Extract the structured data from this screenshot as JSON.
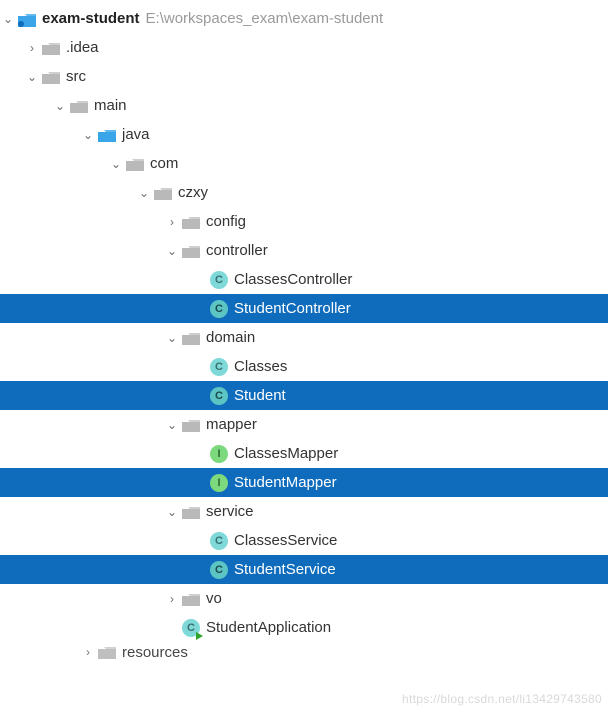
{
  "root": {
    "name": "exam-student",
    "path": "E:\\workspaces_exam\\exam-student"
  },
  "nodes": {
    "idea": ".idea",
    "src": "src",
    "main": "main",
    "java": "java",
    "com": "com",
    "czxy": "czxy",
    "config": "config",
    "controller": "controller",
    "classesController": "ClassesController",
    "studentController": "StudentController",
    "domain": "domain",
    "classes": "Classes",
    "student": "Student",
    "mapper": "mapper",
    "classesMapper": "ClassesMapper",
    "studentMapper": "StudentMapper",
    "service": "service",
    "classesService": "ClassesService",
    "studentService": "StudentService",
    "vo": "vo",
    "studentApplication": "StudentApplication",
    "resources": "resources"
  },
  "watermark": "https://blog.csdn.net/li13429743580"
}
